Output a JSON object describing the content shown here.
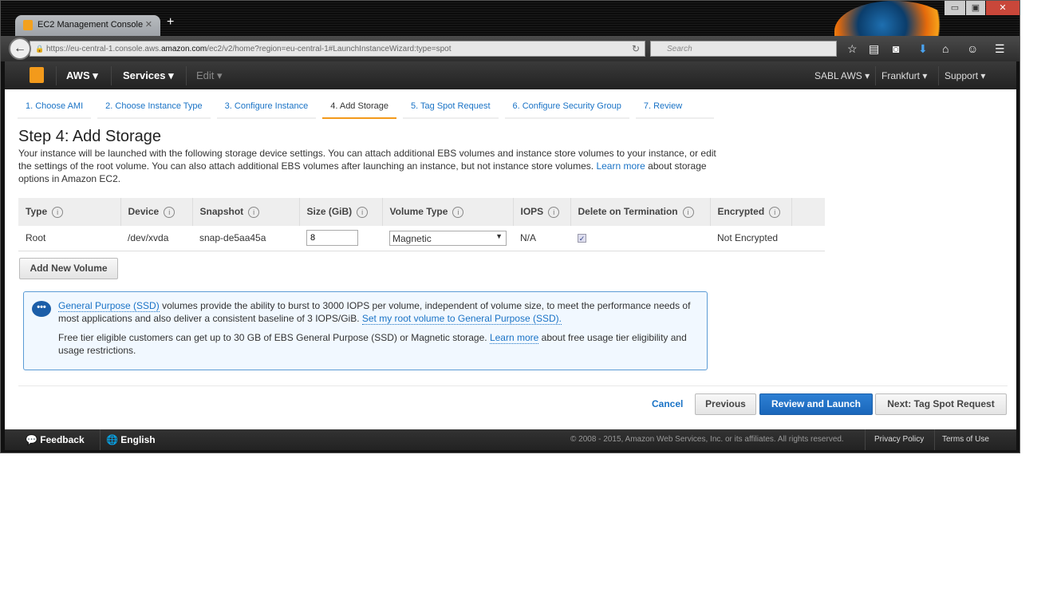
{
  "browser": {
    "tab_title": "EC2 Management Console",
    "url_pre": "https://eu-central-1.console.aws.",
    "url_domain": "amazon.com",
    "url_post": "/ec2/v2/home?region=eu-central-1#LaunchInstanceWizard:type=spot",
    "search_placeholder": "Search"
  },
  "topnav": {
    "aws": "AWS",
    "services": "Services",
    "edit": "Edit",
    "account": "SABL AWS",
    "region": "Frankfurt",
    "support": "Support"
  },
  "steps": [
    {
      "label": "1. Choose AMI"
    },
    {
      "label": "2. Choose Instance Type"
    },
    {
      "label": "3. Configure Instance"
    },
    {
      "label": "4. Add Storage",
      "active": true
    },
    {
      "label": "5. Tag Spot Request"
    },
    {
      "label": "6. Configure Security Group"
    },
    {
      "label": "7. Review"
    }
  ],
  "page": {
    "title": "Step 4: Add Storage",
    "desc": "Your instance will be launched with the following storage device settings. You can attach additional EBS volumes and instance store volumes to your instance, or edit the settings of the root volume. You can also attach additional EBS volumes after launching an instance, but not instance store volumes.",
    "learn_more": "Learn more",
    "desc_end": "about storage options in Amazon EC2."
  },
  "table": {
    "headers": [
      "Type",
      "Device",
      "Snapshot",
      "Size (GiB)",
      "Volume Type",
      "IOPS",
      "Delete on Termination",
      "Encrypted"
    ],
    "row": {
      "type": "Root",
      "device": "/dev/xvda",
      "snapshot": "snap-de5aa45a",
      "size": "8",
      "volume_type": "Magnetic",
      "iops": "N/A",
      "delete_on_termination": true,
      "encrypted": "Not Encrypted"
    }
  },
  "add_volume": "Add New Volume",
  "note": {
    "link1": "General Purpose (SSD)",
    "text1": " volumes provide the ability to burst to 3000 IOPS per volume, independent of volume size, to meet the performance needs of most applications and also deliver a consistent baseline of 3 IOPS/GiB. ",
    "link2": "Set my root volume to General Purpose (SSD).",
    "text2": "Free tier eligible customers can get up to 30 GB of EBS General Purpose (SSD) or Magnetic storage. ",
    "link3": "Learn more",
    "text3": " about free usage tier eligibility and usage restrictions."
  },
  "actions": {
    "cancel": "Cancel",
    "previous": "Previous",
    "review": "Review and Launch",
    "next": "Next: Tag Spot Request"
  },
  "footer": {
    "feedback": "Feedback",
    "language": "English",
    "copyright": "© 2008 - 2015, Amazon Web Services, Inc. or its affiliates. All rights reserved.",
    "privacy": "Privacy Policy",
    "terms": "Terms of Use"
  },
  "colors": {
    "accent": "#f39a1b",
    "link": "#1a73c6",
    "primary": "#1a67bb"
  }
}
